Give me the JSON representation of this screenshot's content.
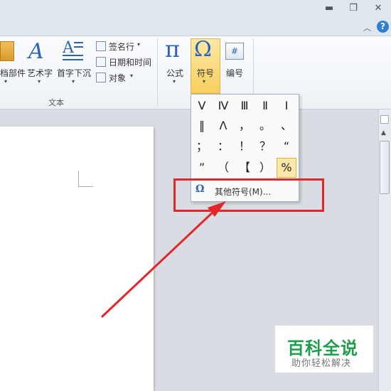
{
  "window": {
    "minimize_icon": "minimize-icon",
    "restore_icon": "restore-icon",
    "close_icon": "close-icon"
  },
  "ribbon_top": {
    "collapse_icon": "chevron-up-icon",
    "help": "?"
  },
  "ribbon": {
    "text_group": {
      "label": "文本",
      "items": [
        "档部件",
        "艺术字",
        "首字下沉"
      ],
      "small_items": [
        "签名行",
        "日期和时间",
        "对象"
      ]
    },
    "symbols_group": {
      "items": [
        "公式",
        "符号",
        "编号"
      ],
      "pi_glyph": "π",
      "omega_glyph": "Ω",
      "hash_glyph": "#"
    }
  },
  "symbol_dropdown": {
    "grid": [
      [
        "Ⅴ",
        "Ⅳ",
        "Ⅲ",
        "Ⅱ",
        "Ⅰ"
      ],
      [
        "‖",
        "Λ",
        "，",
        "。",
        "、"
      ],
      [
        "；",
        "：",
        "！",
        "？",
        "“"
      ],
      [
        "”",
        "（",
        "【",
        "）",
        "%"
      ]
    ],
    "selected": "%",
    "more_symbols_label": "其他符号(M)...",
    "more_symbols_icon": "Ω"
  },
  "watermark": {
    "title": "百科全说",
    "subtitle": "助你轻松解决"
  },
  "colors": {
    "highlight": "#f7cf5d",
    "annotation": "#e3262a",
    "watermark_green": "#1e9e4a"
  }
}
